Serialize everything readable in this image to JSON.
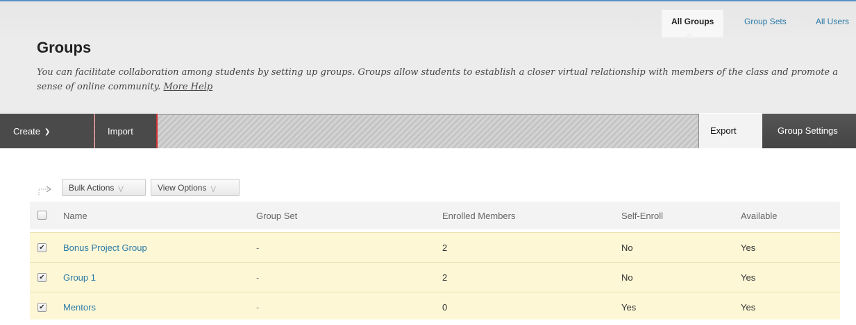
{
  "tabs": [
    {
      "label": "All Groups",
      "active": true
    },
    {
      "label": "Group Sets",
      "active": false
    },
    {
      "label": "All Users",
      "active": false
    }
  ],
  "page": {
    "title": "Groups",
    "description": "You can facilitate collaboration among students by setting up groups. Groups allow students to establish a closer virtual relationship with members of the class and promote a sense of online community.",
    "help_link": "More Help"
  },
  "action_bar": {
    "create_label": "Create",
    "import_label": "Import",
    "export_label": "Export",
    "settings_label": "Group Settings"
  },
  "list_controls": {
    "bulk_actions_label": "Bulk Actions",
    "view_options_label": "View Options"
  },
  "table": {
    "columns": [
      "Name",
      "Group Set",
      "Enrolled Members",
      "Self-Enroll",
      "Available"
    ],
    "rows": [
      {
        "name": "Bonus Project Group",
        "group_set": "-",
        "enrolled": "2",
        "self_enroll": "No",
        "available": "Yes",
        "checked": true
      },
      {
        "name": "Group 1",
        "group_set": "-",
        "enrolled": "2",
        "self_enroll": "No",
        "available": "Yes",
        "checked": true
      },
      {
        "name": "Mentors",
        "group_set": "-",
        "enrolled": "0",
        "self_enroll": "Yes",
        "available": "Yes",
        "checked": true
      }
    ]
  },
  "colors": {
    "link": "#2a7aa6",
    "selected_row": "#fdf7d6",
    "action_bar_dark": "#4a4a4a",
    "accent_red": "#cc3333"
  }
}
